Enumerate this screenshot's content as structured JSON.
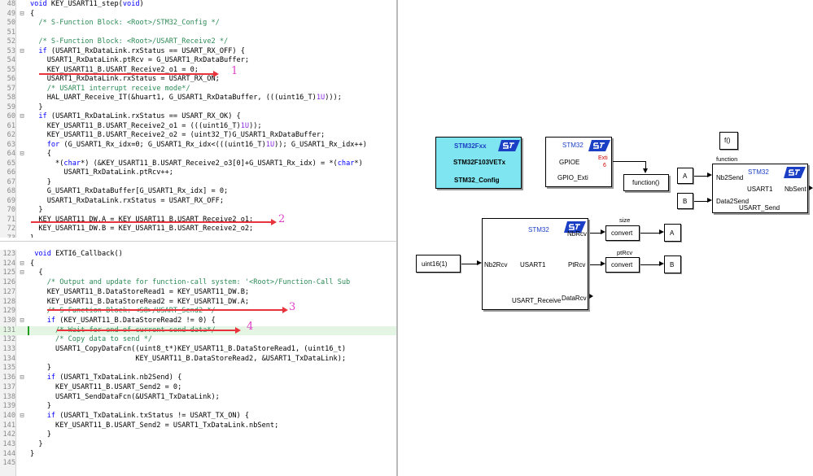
{
  "editor_top": {
    "lines": [
      {
        "n": "48",
        "f": "",
        "t": "void KEY_USART11_step(void)"
      },
      {
        "n": "49",
        "f": "⊟",
        "t": "{"
      },
      {
        "n": "50",
        "f": "",
        "t": "  /* S-Function Block: <Root>/STM32_Config */"
      },
      {
        "n": "51",
        "f": "",
        "t": ""
      },
      {
        "n": "52",
        "f": "",
        "t": "  /* S-Function Block: <Root>/USART_Receive2 */"
      },
      {
        "n": "53",
        "f": "⊟",
        "t": "  if (USART1_RxDataLink.rxStatus == USART_RX_OFF) {"
      },
      {
        "n": "54",
        "f": "",
        "t": "    USART1_RxDataLink.ptRcv = G_USART1_RxDataBuffer;"
      },
      {
        "n": "55",
        "f": "",
        "t": "    KEY_USART11_B.USART_Receive2_o1 = 0;"
      },
      {
        "n": "56",
        "f": "",
        "t": "    USART1_RxDataLink.rxStatus = USART_RX_ON;"
      },
      {
        "n": "57",
        "f": "",
        "t": "    /* USART1 interrupt receive mode*/"
      },
      {
        "n": "58",
        "f": "",
        "t": "    HAL_UART_Receive_IT(&huart1, G_USART1_RxDataBuffer, (((uint16_T)1U)));"
      },
      {
        "n": "59",
        "f": "",
        "t": "  }"
      },
      {
        "n": "60",
        "f": "⊟",
        "t": "  if (USART1_RxDataLink.rxStatus == USART_RX_OK) {"
      },
      {
        "n": "61",
        "f": "",
        "t": "    KEY_USART11_B.USART_Receive2_o1 = (((uint16_T)1U));"
      },
      {
        "n": "62",
        "f": "",
        "t": "    KEY_USART11_B.USART_Receive2_o2 = (uint32_T)G_USART1_RxDataBuffer;"
      },
      {
        "n": "63",
        "f": "",
        "t": "    for (G_USART1_Rx_idx=0; G_USART1_Rx_idx<(((uint16_T)1U)); G_USART1_Rx_idx++)"
      },
      {
        "n": "64",
        "f": "⊟",
        "t": "    {"
      },
      {
        "n": "65",
        "f": "",
        "t": "      *(char*) (&KEY_USART11_B.USART_Receive2_o3[0]+G_USART1_Rx_idx) = *(char*)"
      },
      {
        "n": "66",
        "f": "",
        "t": "        USART1_RxDataLink.ptRcv++;"
      },
      {
        "n": "67",
        "f": "",
        "t": "    }"
      },
      {
        "n": "68",
        "f": "",
        "t": "    G_USART1_RxDataBuffer[G_USART1_Rx_idx] = 0;"
      },
      {
        "n": "69",
        "f": "",
        "t": "    USART1_RxDataLink.rxStatus = USART_RX_OFF;"
      },
      {
        "n": "70",
        "f": "",
        "t": "  }"
      },
      {
        "n": "71",
        "f": "",
        "t": "  KEY_USART11_DW.A = KEY_USART11_B.USART_Receive2_o1;"
      },
      {
        "n": "72",
        "f": "",
        "t": "  KEY_USART11_DW.B = KEY_USART11_B.USART_Receive2_o2;"
      },
      {
        "n": "73",
        "f": "",
        "t": "}"
      }
    ]
  },
  "editor_bottom": {
    "lines": [
      {
        "n": "123",
        "f": "",
        "t": " void EXTI6_Callback()"
      },
      {
        "n": "124",
        "f": "⊟",
        "t": "{"
      },
      {
        "n": "125",
        "f": "⊟",
        "t": "  {"
      },
      {
        "n": "126",
        "f": "",
        "t": "    /* Output and update for function-call system: '<Root>/Function-Call Sub"
      },
      {
        "n": "127",
        "f": "",
        "t": "    KEY_USART11_B.DataStoreRead1 = KEY_USART11_DW.B;"
      },
      {
        "n": "128",
        "f": "",
        "t": "    KEY_USART11_B.DataStoreRead2 = KEY_USART11_DW.A;"
      },
      {
        "n": "129",
        "f": "",
        "t": "    /* S-Function Block: <S8>/USART_Send2 */"
      },
      {
        "n": "130",
        "f": "⊟",
        "t": "    if (KEY_USART11_B.DataStoreRead2 != 0) {"
      },
      {
        "n": "131",
        "f": "",
        "t": "      /* Wait for end of current send data*/"
      },
      {
        "n": "132",
        "f": "",
        "t": "      /* Copy data to send */"
      },
      {
        "n": "133",
        "f": "",
        "t": "      USART1_CopyDataFcn((uint8_t*)KEY_USART11_B.DataStoreRead1, (uint16_t)"
      },
      {
        "n": "134",
        "f": "",
        "t": "                         KEY_USART11_B.DataStoreRead2, &USART1_TxDataLink);"
      },
      {
        "n": "135",
        "f": "",
        "t": "    }"
      },
      {
        "n": "136",
        "f": "⊟",
        "t": "    if (USART1_TxDataLink.nb2Send) {"
      },
      {
        "n": "137",
        "f": "",
        "t": "      KEY_USART11_B.USART_Send2 = 0;"
      },
      {
        "n": "138",
        "f": "",
        "t": "      USART1_SendDataFcn(&USART1_TxDataLink);"
      },
      {
        "n": "139",
        "f": "",
        "t": "    }"
      },
      {
        "n": "140",
        "f": "⊟",
        "t": "    if (USART1_TxDataLink.txStatus != USART_TX_ON) {"
      },
      {
        "n": "141",
        "f": "",
        "t": "      KEY_USART11_B.USART_Send2 = USART1_TxDataLink.nbSent;"
      },
      {
        "n": "142",
        "f": "",
        "t": "    }"
      },
      {
        "n": "143",
        "f": "",
        "t": "  }"
      },
      {
        "n": "144",
        "f": "",
        "t": "}"
      },
      {
        "n": "145",
        "f": "",
        "t": ""
      }
    ]
  },
  "annotations": [
    "1",
    "2",
    "3",
    "4"
  ],
  "model": {
    "config": {
      "line1": "STM32Fxx",
      "line2": "STM32F103VETx",
      "line3": "STM32_Config"
    },
    "gpio": {
      "title": "STM32",
      "port": "GPIOE",
      "exti": "Exti",
      "pin": "6",
      "name": "GPIO_Exti"
    },
    "function_block": {
      "label": "function()"
    },
    "fcall_sub": {
      "icon": "f()",
      "name": "function"
    },
    "usart_send": {
      "title": "STM32",
      "in1": "Nb2Send",
      "in2": "Data2Send",
      "periph": "USART1",
      "out": "NbSent",
      "name": "USART_Send"
    },
    "const_a": "A",
    "const_b": "B",
    "usart_receive": {
      "title": "STM32",
      "in": "Nb2Rcv",
      "periph": "USART1",
      "out1": "NbRcv",
      "out2": "PtRcv",
      "out3": "DataRcv",
      "name": "USART_Receive"
    },
    "uint_const": "uint16(1)",
    "convert1": {
      "label": "convert",
      "name": "size"
    },
    "convert2": {
      "label": "convert",
      "name": "ptRcv"
    },
    "store_a": "A",
    "store_b": "B"
  },
  "colors": {
    "config_fill": "#7fe5f0",
    "annotation_arrow": "#e8323c",
    "annotation_number": "#e040c8",
    "comment": "#2e8b57",
    "keyword": "#0000ff",
    "number": "#8a2be2",
    "st_logo": "#1a3fc4"
  }
}
